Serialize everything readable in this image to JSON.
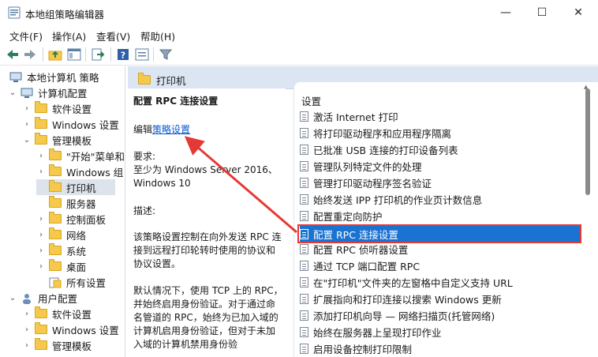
{
  "window": {
    "title": "本地组策略编辑器",
    "minimize": "—",
    "maximize": "☐",
    "close": "✕"
  },
  "menu": [
    "文件(F)",
    "操作(A)",
    "查看(V)",
    "帮助(H)"
  ],
  "tree": [
    {
      "label": "本地计算机 策略",
      "indent": 0,
      "arrow": "",
      "icon": "computer-policy-icon"
    },
    {
      "label": "计算机配置",
      "indent": 1,
      "arrow": "v",
      "icon": "computer-icon"
    },
    {
      "label": "软件设置",
      "indent": 2,
      "arrow": ">",
      "icon": "folder-icon"
    },
    {
      "label": "Windows 设置",
      "indent": 2,
      "arrow": ">",
      "icon": "folder-icon"
    },
    {
      "label": "管理模板",
      "indent": 2,
      "arrow": "v",
      "icon": "folder-icon"
    },
    {
      "label": "\"开始\"菜单和",
      "indent": 3,
      "arrow": ">",
      "icon": "folder-icon"
    },
    {
      "label": "Windows 组",
      "indent": 3,
      "arrow": ">",
      "icon": "folder-icon"
    },
    {
      "label": "打印机",
      "indent": 3,
      "arrow": "",
      "icon": "folder-icon",
      "selected": true
    },
    {
      "label": "服务器",
      "indent": 3,
      "arrow": "",
      "icon": "folder-icon"
    },
    {
      "label": "控制面板",
      "indent": 3,
      "arrow": ">",
      "icon": "folder-icon"
    },
    {
      "label": "网络",
      "indent": 3,
      "arrow": ">",
      "icon": "folder-icon"
    },
    {
      "label": "系统",
      "indent": 3,
      "arrow": ">",
      "icon": "folder-icon"
    },
    {
      "label": "桌面",
      "indent": 3,
      "arrow": ">",
      "icon": "folder-icon"
    },
    {
      "label": "所有设置",
      "indent": 3,
      "arrow": "",
      "icon": "all-settings-icon"
    },
    {
      "label": "用户配置",
      "indent": 1,
      "arrow": "v",
      "icon": "user-icon"
    },
    {
      "label": "软件设置",
      "indent": 2,
      "arrow": ">",
      "icon": "folder-icon"
    },
    {
      "label": "Windows 设置",
      "indent": 2,
      "arrow": ">",
      "icon": "folder-icon"
    },
    {
      "label": "管理模板",
      "indent": 2,
      "arrow": ">",
      "icon": "folder-icon"
    }
  ],
  "header": {
    "folder_title": "打印机"
  },
  "description": {
    "title": "配置 RPC 连接设置",
    "edit_prefix": "编辑",
    "edit_link": "策略设置",
    "requirements_label": "要求:",
    "requirements_text": "至少为 Windows Server 2016、Windows 10",
    "desc_label": "描述:",
    "para1": "该策略设置控制在向外发送 RPC 连接到远程打印轮转时使用的协议和协议设置。",
    "para2": "默认情况下，使用 TCP 上的 RPC，并始终启用身份验证。对于通过命名管道的 RPC，始终为已加入域的计算机启用身份验证，但对于未加入域的计算机禁用身份验"
  },
  "settings": {
    "header": "设置",
    "items": [
      "激活 Internet 打印",
      "将打印驱动程序和应用程序隔离",
      "已批准 USB 连接的打印设备列表",
      "管理队列特定文件的处理",
      "管理打印驱动程序签名验证",
      "始终发送 IPP 打印机的作业页计数信息",
      "配置重定向防护",
      "配置 RPC 连接设置",
      "配置 RPC 侦听器设置",
      "通过 TCP 端口配置 RPC",
      "在\"打印机\"文件夹的左窗格中自定义支持 URL",
      "扩展指向和打印连接以搜索 Windows 更新",
      "添加打印机向导 — 网络扫描页(托管网络)",
      "始终在服务器上呈现打印作业",
      "启用设备控制打印限制"
    ],
    "selected_index": 7
  },
  "colors": {
    "selection": "#1a73d1",
    "highlight_box": "#e53935",
    "arrow": "#e53935",
    "header_bg": "#dbe6f2"
  }
}
